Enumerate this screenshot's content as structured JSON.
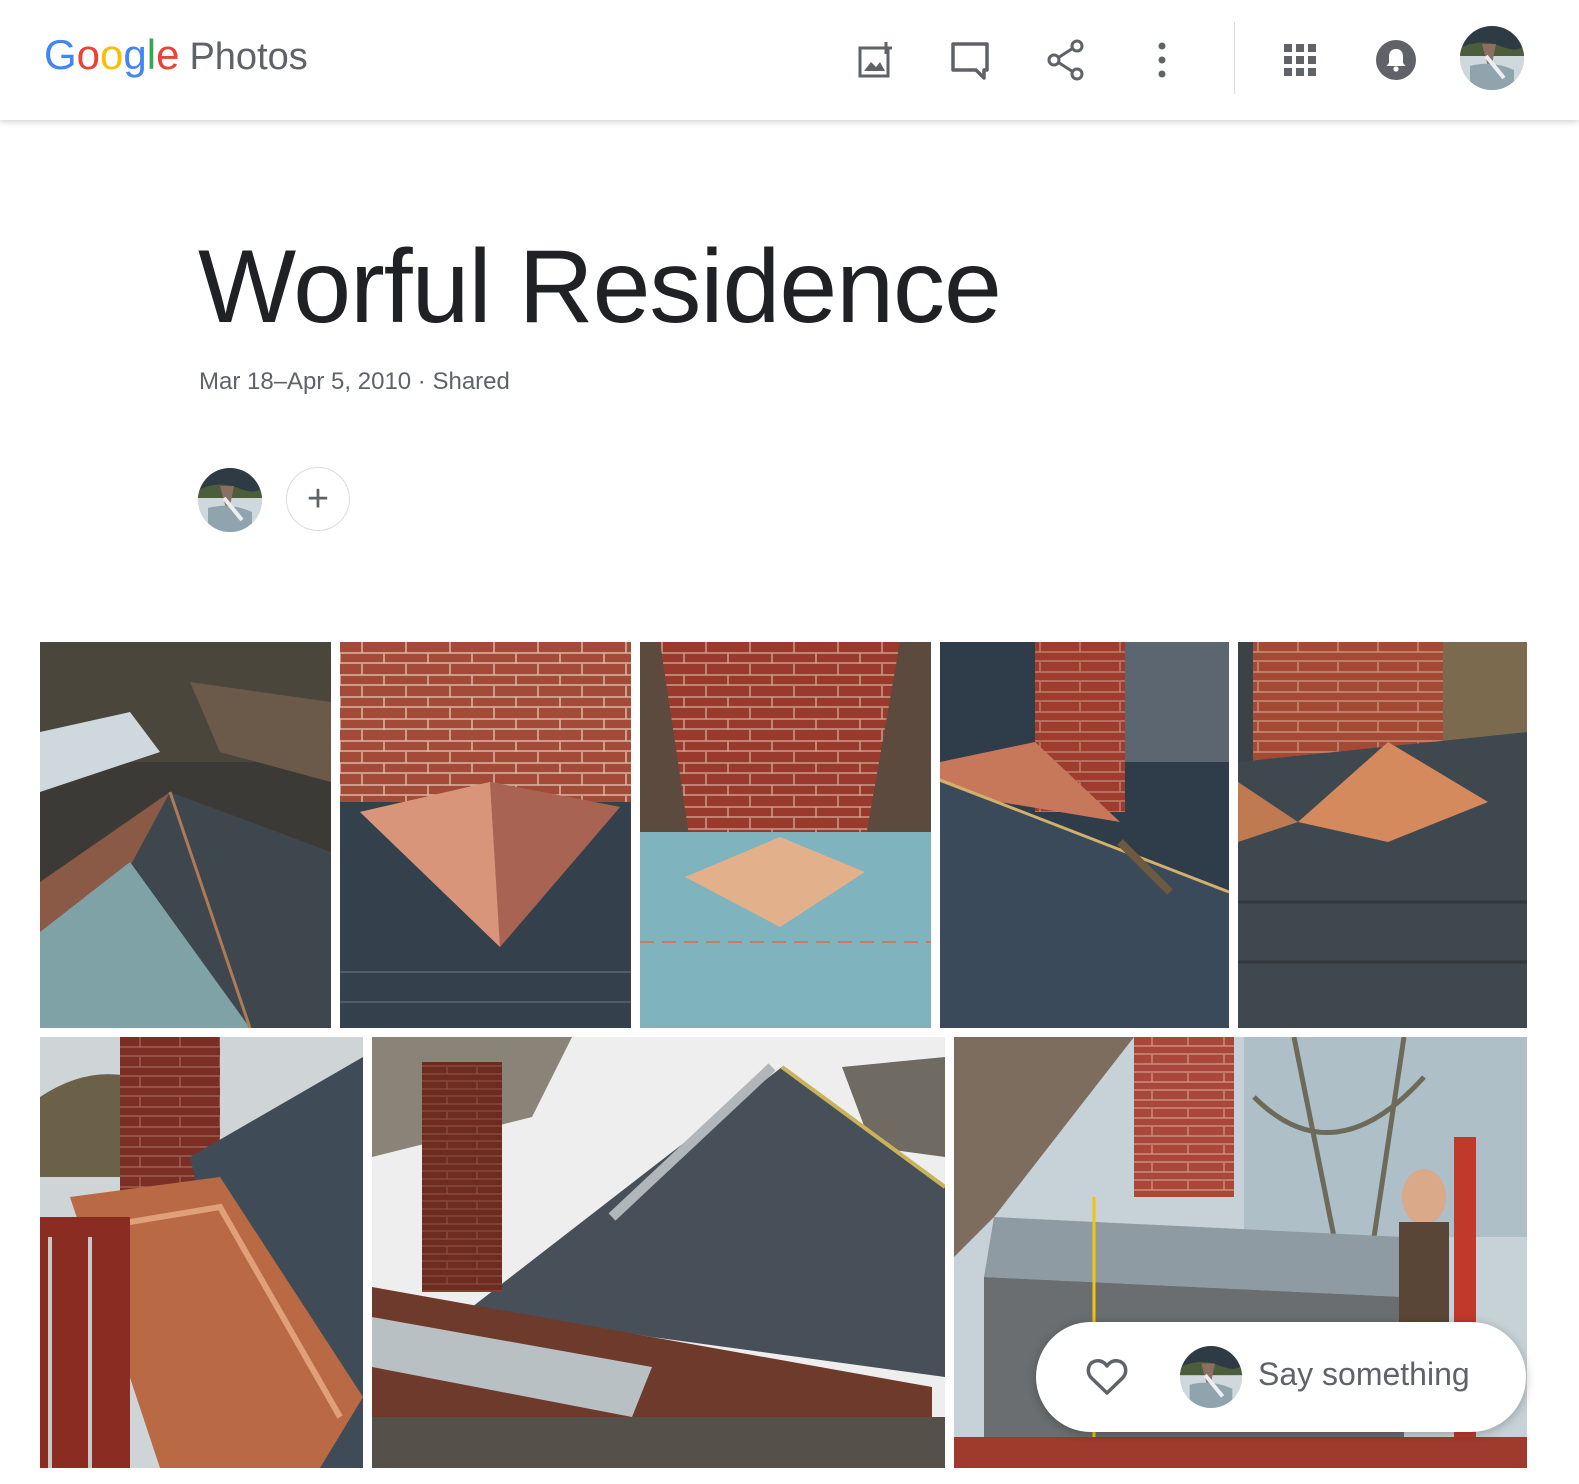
{
  "header": {
    "logo": {
      "letters": [
        "G",
        "o",
        "o",
        "g",
        "l",
        "e"
      ],
      "product": "Photos"
    },
    "icons": [
      "add-photos-icon",
      "comment-icon",
      "share-icon",
      "more-vert-icon",
      "apps-grid-icon",
      "notifications-icon"
    ]
  },
  "album": {
    "title": "Worful Residence",
    "subtitle": "Mar 18–Apr 5, 2010 · Shared",
    "add_member_symbol": "+"
  },
  "photos": [
    {
      "id": "photo-1",
      "subject": "copper-hip-roof-corner"
    },
    {
      "id": "photo-2",
      "subject": "copper-cricket-brick-wall"
    },
    {
      "id": "photo-3",
      "subject": "chimney-underlayment"
    },
    {
      "id": "photo-4",
      "subject": "chimney-copper-flashing-slate"
    },
    {
      "id": "photo-5",
      "subject": "chimney-copper-cricket"
    },
    {
      "id": "photo-6",
      "subject": "copper-gutter-chimney"
    },
    {
      "id": "photo-7",
      "subject": "slate-roof-ladder"
    },
    {
      "id": "photo-8",
      "subject": "worker-on-scaffold"
    }
  ],
  "comment_bar": {
    "placeholder": "Say something"
  },
  "colors": {
    "google_blue": "#4285f4",
    "google_red": "#ea4335",
    "google_yellow": "#fbbc05",
    "google_green": "#34a853",
    "text_primary": "#202124",
    "text_secondary": "#5f6368",
    "brick": "#9c3b2a",
    "copper": "#c57a52",
    "slate": "#3f4a55"
  }
}
